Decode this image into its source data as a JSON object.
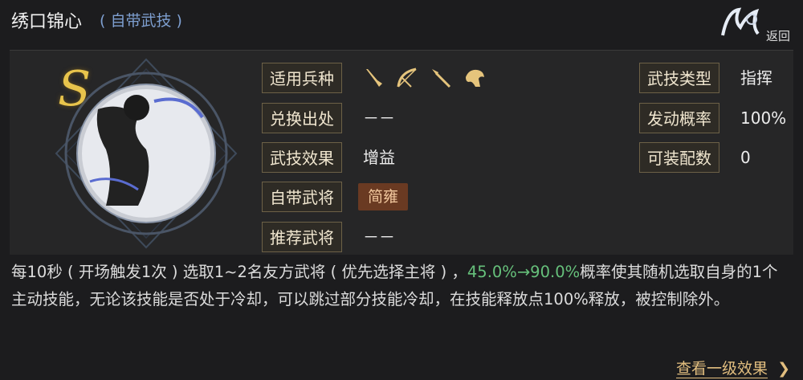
{
  "header": {
    "title": "绣口锦心",
    "subtitle": "( 自带武技 )",
    "back_label": "返回"
  },
  "grade": "S",
  "left_fields": [
    {
      "label": "适用兵种",
      "value": ""
    },
    {
      "label": "兑换出处",
      "value": "－－"
    },
    {
      "label": "武技效果",
      "value": "增益"
    },
    {
      "label": "自带武将",
      "value": "简雍"
    },
    {
      "label": "推荐武将",
      "value": "－－"
    }
  ],
  "troop_icons": [
    "sword-icon",
    "bow-icon",
    "spear-icon",
    "horse-icon"
  ],
  "right_fields": [
    {
      "label": "武技类型",
      "value": "指挥"
    },
    {
      "label": "发动概率",
      "value": "100%"
    },
    {
      "label": "可装配数",
      "value": "0"
    }
  ],
  "description": {
    "part1": "每10秒 ( 开场触发1次 ) 选取1~2名友方武将 ( 优先选择主将 ) ，",
    "highlight": "45.0%→90.0%",
    "part2": "概率使其随机选取自身的1个主动技能，无论该技能是否处于冷却，可以跳过部分技能冷却，在技能释放点100%释放，被控制除外。"
  },
  "bottom_link": "查看一级效果",
  "colors": {
    "background": "#1c1c1e",
    "label_border": "#6d6147",
    "highlight_green": "#66c07b",
    "link_gold": "#e2be7f",
    "general_tag": "#6a3a22"
  }
}
